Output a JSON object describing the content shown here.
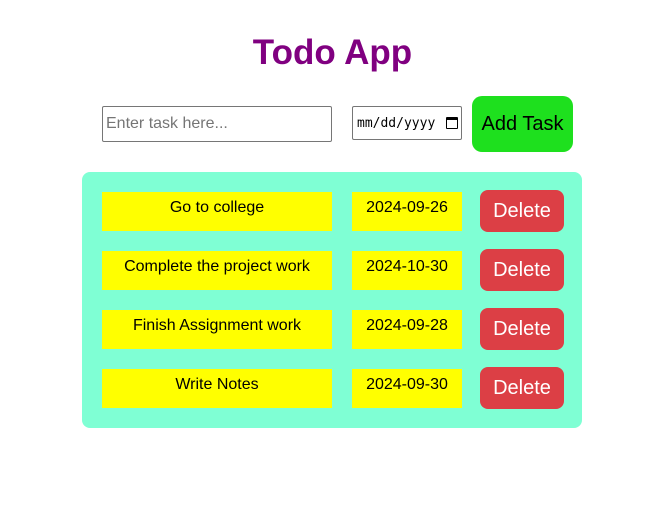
{
  "app": {
    "title": "Todo App"
  },
  "form": {
    "task_placeholder": "Enter task here...",
    "task_value": "",
    "date_placeholder": "mm/dd/yyyy",
    "add_label": "Add Task"
  },
  "tasks": [
    {
      "name": "Go to college",
      "date": "2024-09-26",
      "delete_label": "Delete"
    },
    {
      "name": "Complete the project work",
      "date": "2024-10-30",
      "delete_label": "Delete"
    },
    {
      "name": "Finish Assignment work",
      "date": "2024-09-28",
      "delete_label": "Delete"
    },
    {
      "name": "Write Notes",
      "date": "2024-09-30",
      "delete_label": "Delete"
    }
  ],
  "colors": {
    "title": "#800080",
    "add_button": "#1ee01e",
    "list_background": "#7fffd4",
    "task_cell": "#ffff00",
    "delete_button": "#dc3f45"
  },
  "icons": {
    "date_picker": "calendar-icon"
  }
}
